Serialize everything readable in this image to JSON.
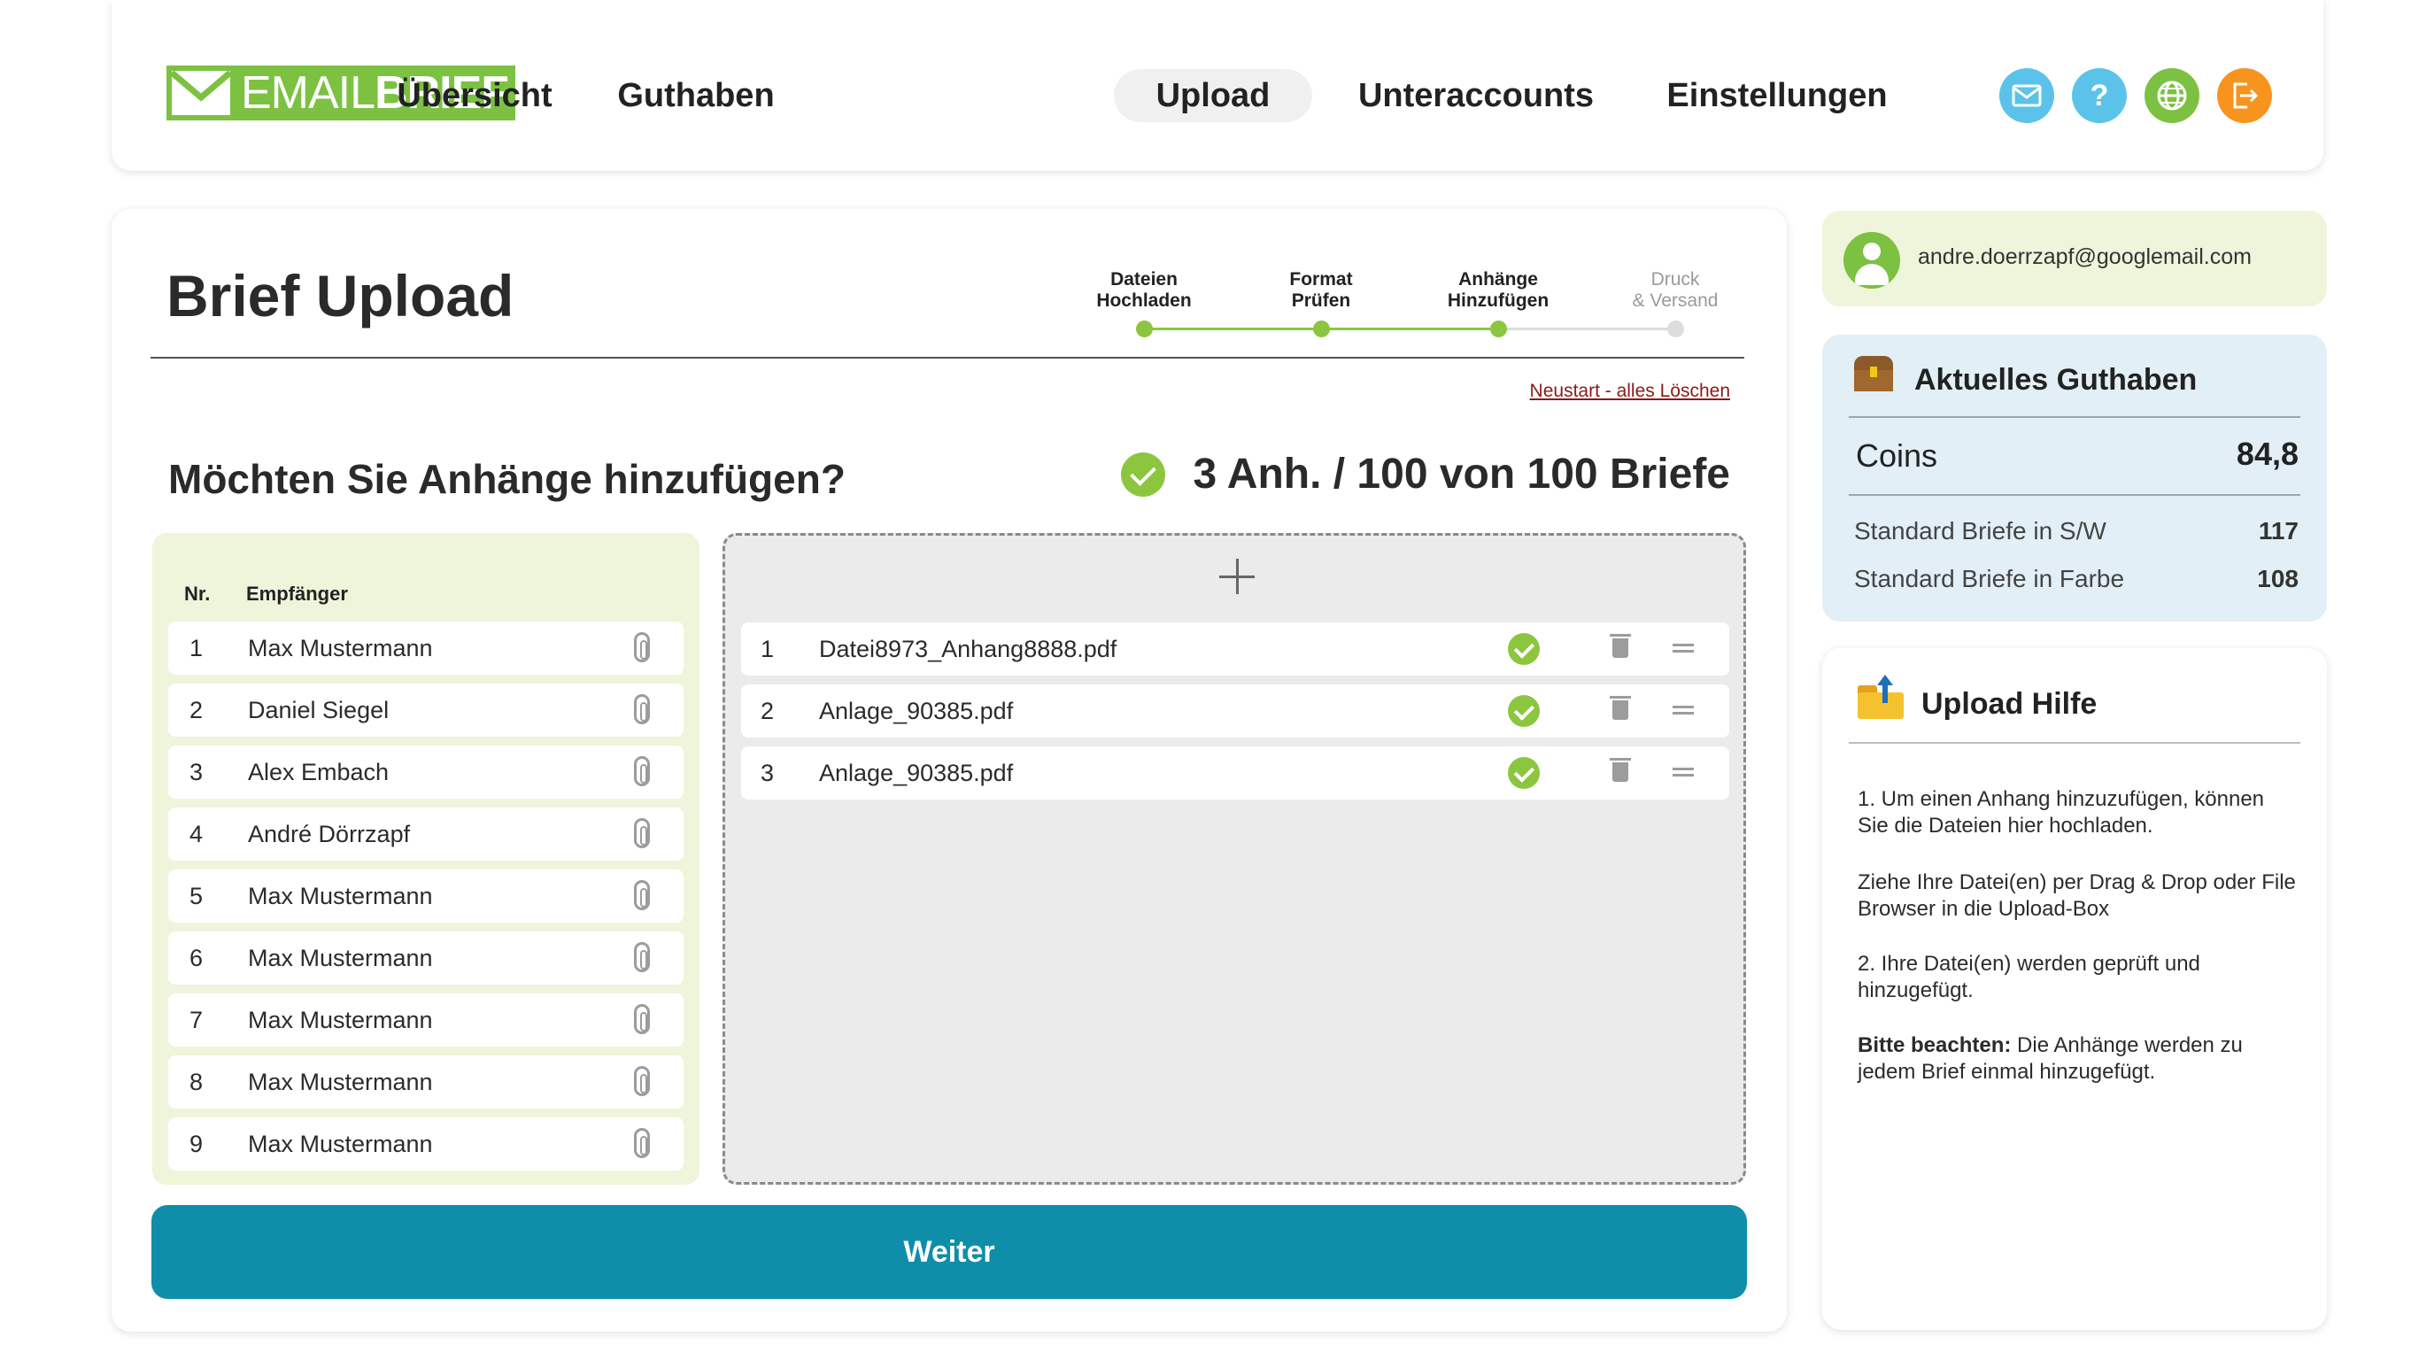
{
  "brand": {
    "logo_light": "EMAIL",
    "logo_bold": "BRIEF",
    "color": "#7cc142"
  },
  "nav": {
    "items": [
      "Übersicht",
      "Guthaben",
      "Upload",
      "Unteraccounts",
      "Einstellungen"
    ],
    "active": "Upload"
  },
  "header_icons": [
    {
      "name": "mail-icon",
      "color": "#5bc3ea"
    },
    {
      "name": "help-icon",
      "color": "#5bc3ea",
      "glyph": "?"
    },
    {
      "name": "globe-icon",
      "color": "#7cc142"
    },
    {
      "name": "logout-icon",
      "color": "#f7941d"
    }
  ],
  "main": {
    "title": "Brief Upload",
    "steps": [
      {
        "line1": "Dateien",
        "line2": "Hochladen",
        "done": true
      },
      {
        "line1": "Format",
        "line2": "Prüfen",
        "done": true
      },
      {
        "line1": "Anhänge",
        "line2": "Hinzufügen",
        "done": true
      },
      {
        "line1": "Druck",
        "line2": "& Versand",
        "done": false
      }
    ],
    "reset_link": "Neustart - alles Löschen",
    "question": "Möchten Sie Anhänge hinzufügen?",
    "summary": "3 Anh. /  100 von 100 Briefe",
    "recipients_header": {
      "nr": "Nr.",
      "name": "Empfänger"
    },
    "recipients": [
      {
        "nr": "1",
        "name": "Max Mustermann"
      },
      {
        "nr": "2",
        "name": "Daniel Siegel"
      },
      {
        "nr": "3",
        "name": "Alex Embach"
      },
      {
        "nr": "4",
        "name": "André Dörrzapf"
      },
      {
        "nr": "5",
        "name": "Max Mustermann"
      },
      {
        "nr": "6",
        "name": "Max Mustermann"
      },
      {
        "nr": "7",
        "name": "Max Mustermann"
      },
      {
        "nr": "8",
        "name": "Max Mustermann"
      },
      {
        "nr": "9",
        "name": "Max Mustermann"
      }
    ],
    "files": [
      {
        "nr": "1",
        "name": "Datei8973_Anhang8888.pdf"
      },
      {
        "nr": "2",
        "name": "Anlage_90385.pdf"
      },
      {
        "nr": "3",
        "name": "Anlage_90385.pdf"
      }
    ],
    "continue_label": "Weiter"
  },
  "user": {
    "email": "andre.doerrzapf@googlemail.com"
  },
  "credit": {
    "title": "Aktuelles Guthaben",
    "coins_label": "Coins",
    "coins_value": "84,8",
    "bw_label": "Standard Briefe in S/W",
    "bw_value": "117",
    "color_label": "Standard Briefe in Farbe",
    "color_value": "108"
  },
  "help": {
    "title": "Upload Hilfe",
    "p1": "1. Um einen Anhang hinzuzufügen, können Sie die Dateien hier hochladen.",
    "p2": "Ziehe Ihre Datei(en) per Drag & Drop oder File Browser in die Upload-Box",
    "p3": "2. Ihre Datei(en) werden geprüft und hinzugefügt.",
    "p4_bold": "Bitte beachten:",
    "p4_rest": " Die Anhänge werden zu jedem Brief einmal hinzugefügt."
  },
  "colors": {
    "accent": "#0e8ea9",
    "green": "#8cc63f",
    "panel_green": "#eef5da",
    "panel_blue": "#e2eff6"
  }
}
